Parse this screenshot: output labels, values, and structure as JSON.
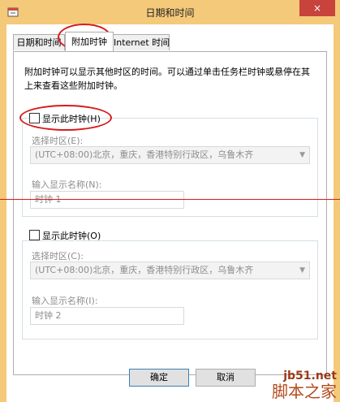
{
  "window": {
    "title": "日期和时间",
    "close_symbol": "×"
  },
  "tabs": [
    {
      "label": "日期和时间"
    },
    {
      "label": "附加时钟",
      "active": true
    },
    {
      "label": "Internet 时间"
    }
  ],
  "description": "附加时钟可以显示其他时区的时间。可以通过单击任务栏时钟或悬停在其上来查看这些附加时钟。",
  "clock1": {
    "show_label": "显示此时钟(H)",
    "checked": false,
    "timezone_label": "选择时区(E):",
    "timezone_value": "(UTC+08:00)北京，重庆，香港特别行政区，乌鲁木齐",
    "name_label": "输入显示名称(N):",
    "name_value": "时钟 1"
  },
  "clock2": {
    "show_label": "显示此时钟(O)",
    "checked": false,
    "timezone_label": "选择时区(C):",
    "timezone_value": "(UTC+08:00)北京，重庆，香港特别行政区，乌鲁木齐",
    "name_label": "输入显示名称(I):",
    "name_value": "时钟 2"
  },
  "buttons": {
    "ok": "确定",
    "cancel": "取消"
  },
  "watermark": {
    "site": "jb51.net",
    "name": "脚本之家"
  },
  "colors": {
    "titlebar": "#f4c97a",
    "close": "#c7433b",
    "annotation": "#d51c1c"
  },
  "icons": {
    "app": "clock-icon",
    "close": "close-icon",
    "dropdown": "chevron-down-icon"
  }
}
